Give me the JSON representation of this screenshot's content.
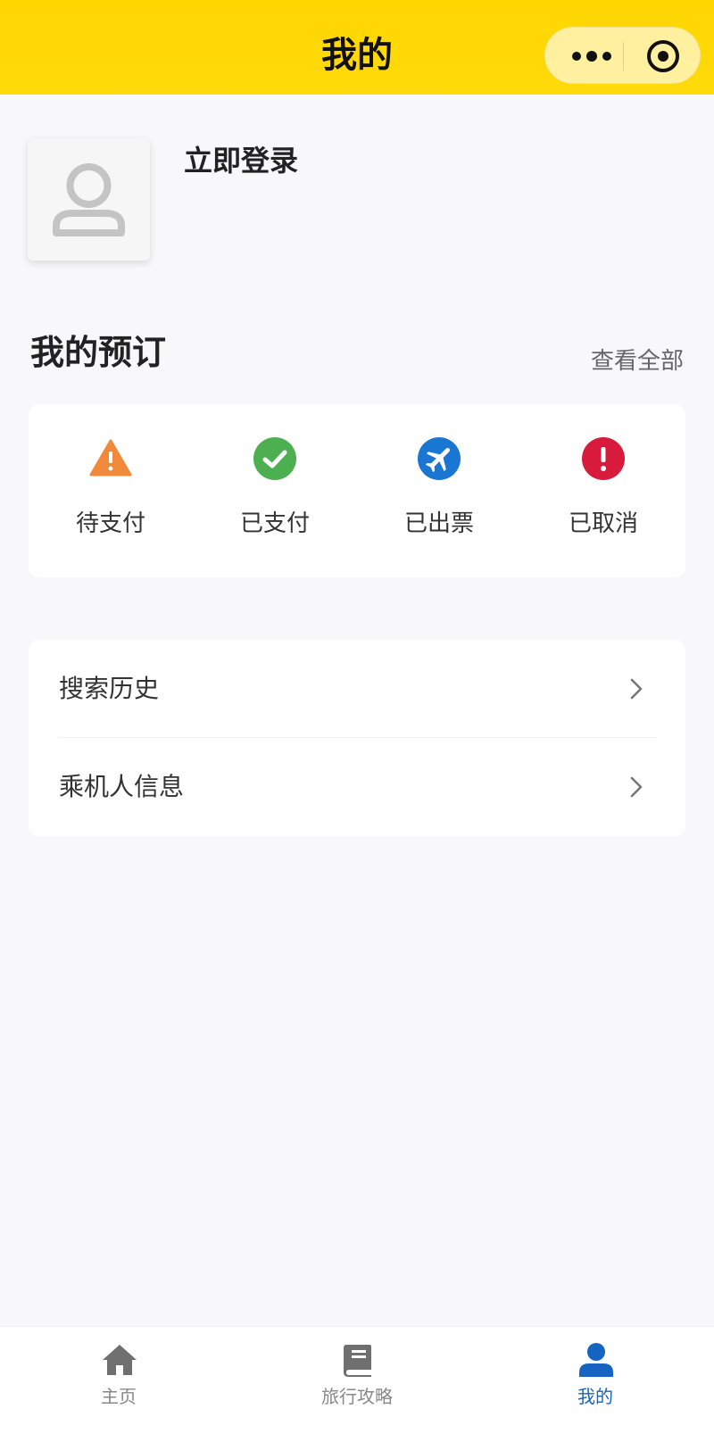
{
  "header": {
    "title": "我的",
    "more_icon": "more-dots-icon",
    "close_icon": "target-close-icon"
  },
  "profile": {
    "avatar_icon": "user-placeholder-icon",
    "login_label": "立即登录"
  },
  "bookings": {
    "title": "我的预订",
    "view_all": "查看全部",
    "items": [
      {
        "label": "待支付",
        "icon": "warning-triangle-icon",
        "color": "#f08a3a"
      },
      {
        "label": "已支付",
        "icon": "check-circle-icon",
        "color": "#4caf50"
      },
      {
        "label": "已出票",
        "icon": "airplane-circle-icon",
        "color": "#1976d2"
      },
      {
        "label": "已取消",
        "icon": "exclamation-circle-icon",
        "color": "#d81b3c"
      }
    ]
  },
  "menu": {
    "items": [
      {
        "label": "搜索历史"
      },
      {
        "label": "乘机人信息"
      }
    ]
  },
  "tabbar": {
    "items": [
      {
        "label": "主页",
        "icon": "home-icon"
      },
      {
        "label": "旅行攻略",
        "icon": "book-icon"
      },
      {
        "label": "我的",
        "icon": "person-icon",
        "active": true
      }
    ],
    "active_color": "#1565c0",
    "inactive_color": "#888888"
  },
  "colors": {
    "header_bg": "#ffd800",
    "page_bg": "#f8f8fa"
  }
}
